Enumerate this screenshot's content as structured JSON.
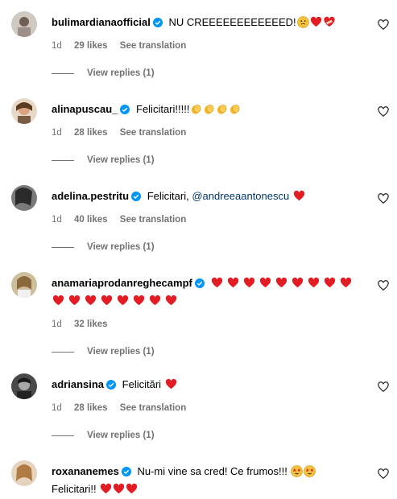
{
  "comments": [
    {
      "username": "bulimardianaofficial",
      "text": "NU CREEEEEEEEEEEED!",
      "emojis": [
        "neutral-face",
        "heart-red",
        "heart-mending"
      ],
      "mention": "",
      "tail": "",
      "time": "1d",
      "likes": "29 likes",
      "translate": "See translation",
      "replies": "View replies (1)",
      "avatar_color": "#b9b3ac"
    },
    {
      "username": "alinapuscau_",
      "text": "Felicitari!!!!!",
      "emojis": [
        "clap",
        "clap",
        "clap",
        "clap"
      ],
      "mention": "",
      "tail": "",
      "time": "1d",
      "likes": "28 likes",
      "translate": "See translation",
      "replies": "View replies (1)",
      "avatar_color": "#c58f6e"
    },
    {
      "username": "adelina.pestritu",
      "text": "Felicitari, ",
      "emojis": [
        "heart-red"
      ],
      "mention": "@andreeaantonescu",
      "tail": "",
      "time": "1d",
      "likes": "40 likes",
      "translate": "See translation",
      "replies": "View replies (1)",
      "avatar_color": "#5a5a5a"
    },
    {
      "username": "anamariaprodanreghecampf",
      "text": "",
      "emojis": [
        "heart-red",
        "heart-red",
        "heart-red",
        "heart-red",
        "heart-red",
        "heart-red",
        "heart-red",
        "heart-red",
        "heart-red",
        "heart-red",
        "heart-red",
        "heart-red",
        "heart-red",
        "heart-red",
        "heart-red",
        "heart-red",
        "heart-red"
      ],
      "mention": "",
      "tail": "",
      "time": "1d",
      "likes": "32 likes",
      "translate": "",
      "replies": "View replies (1)",
      "avatar_color": "#8a7a5e"
    },
    {
      "username": "adriansina",
      "text": "Felicitări",
      "emojis": [
        "heart-red"
      ],
      "mention": "",
      "tail": "",
      "time": "1d",
      "likes": "28 likes",
      "translate": "See translation",
      "replies": "View replies (1)",
      "avatar_color": "#3b3b3b"
    },
    {
      "username": "roxananemes",
      "text": "Nu-mi vine sa cred! Ce frumos!!!",
      "emojis": [
        "star-struck",
        "star-struck"
      ],
      "mention": "",
      "tail": "Felicitari!!",
      "tail_emojis": [
        "heart-red",
        "heart-red",
        "heart-red"
      ],
      "time": "",
      "likes": "",
      "translate": "",
      "replies": "",
      "avatar_color": "#c9a27a"
    }
  ],
  "colors": {
    "verified": "#0095f6",
    "muted": "#737373",
    "mention": "#00376b",
    "heart": "#e0245e"
  }
}
